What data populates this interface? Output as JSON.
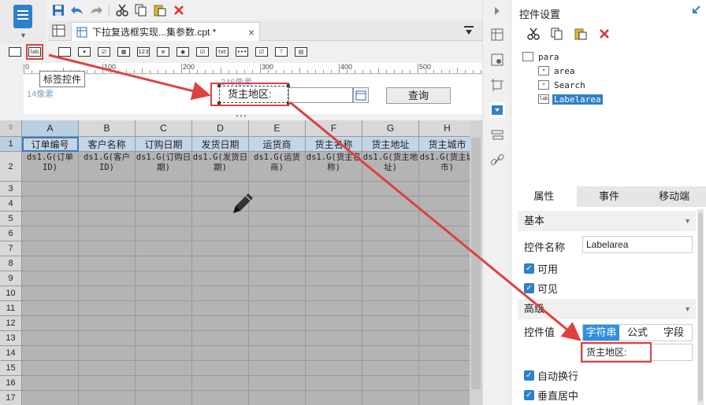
{
  "tab": {
    "title": "下拉复选框实现...集参数.cpt *"
  },
  "tooltip": "标签控件",
  "ruler": {
    "ticks": [
      "0",
      "100",
      "200",
      "300",
      "400",
      "500"
    ]
  },
  "param_pane": {
    "px_left": "14像素",
    "px_top": "246像素",
    "label_text": "货主地区:",
    "query_button": "查询"
  },
  "sheet": {
    "columns": [
      "A",
      "B",
      "C",
      "D",
      "E",
      "F",
      "G",
      "H"
    ],
    "rows": [
      "1",
      "2",
      "3",
      "4",
      "5",
      "6",
      "7",
      "8",
      "9",
      "10",
      "11",
      "12",
      "13",
      "14",
      "15",
      "16",
      "17"
    ],
    "header_row": [
      "订单编号",
      "客户名称",
      "订购日期",
      "发货日期",
      "运货商",
      "货主名称",
      "货主地址",
      "货主城市"
    ],
    "data_row": [
      "ds1.G(订单ID)",
      "ds1.G(客户ID)",
      "ds1.G(订购日期)",
      "ds1.G(发货日期)",
      "ds1.G(运货商)",
      "ds1.G(货主名称)",
      "ds1.G(货主地址)",
      "ds1.G(货主城市)"
    ]
  },
  "panel": {
    "title": "控件设置",
    "tree": {
      "root": "para",
      "children": [
        "area",
        "Search",
        "Labelarea"
      ],
      "selected": "Labelarea"
    },
    "tabs": [
      "属性",
      "事件",
      "移动端"
    ],
    "sections": {
      "basic": "基本",
      "advanced": "高级"
    },
    "name_label": "控件名称",
    "name_value": "Labelarea",
    "checks": [
      "可用",
      "可见"
    ],
    "value_label": "控件值",
    "value_types": [
      "字符串",
      "公式",
      "字段"
    ],
    "value_text": "货主地区:",
    "checks2": [
      "自动换行",
      "垂直居中"
    ]
  },
  "colors": {
    "accent": "#2f7fc9",
    "highlight": "#e04040"
  }
}
